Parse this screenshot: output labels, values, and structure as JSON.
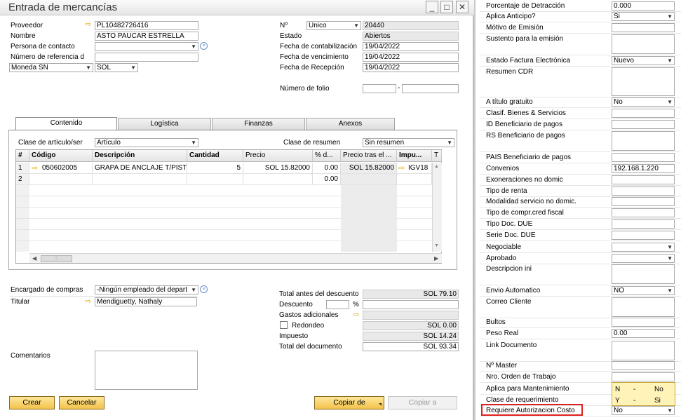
{
  "window": {
    "title": "Entrada de mercancías",
    "min": "_",
    "max": "□",
    "close": "✕"
  },
  "header_left": {
    "proveedor_label": "Proveedor",
    "proveedor": "PL10482726416",
    "nombre_label": "Nombre",
    "nombre": "ASTO PAUCAR ESTRELLA",
    "contacto_label": "Persona de contacto",
    "contacto": "",
    "referencia_label": "Número de referencia d",
    "referencia": "",
    "moneda_label": "Moneda SN",
    "moneda": "SOL"
  },
  "header_right": {
    "no_label": "Nº",
    "serie": "Unico",
    "numero": "20440",
    "estado_label": "Estado",
    "estado": "Abiertos",
    "fcont_label": "Fecha de contabilización",
    "fcont": "19/04/2022",
    "fvenc_label": "Fecha de vencimiento",
    "fvenc": "19/04/2022",
    "frec_label": "Fecha de Recepción",
    "frec": "19/04/2022",
    "folio_label": "Número de folio",
    "folio_sep": "-"
  },
  "tabs": [
    "Contenido",
    "Logística",
    "Finanzas",
    "Anexos"
  ],
  "content": {
    "clase_label": "Clase de artículo/ser",
    "clase": "Artículo",
    "resumen_label": "Clase de resumen",
    "resumen": "Sin resumen",
    "columns": [
      "#",
      "Código",
      "Descripción",
      "Cantidad",
      "Precio",
      "% d...",
      "Precio tras el ...",
      "Impu...",
      "T"
    ],
    "rows": [
      [
        "1",
        "050602005",
        "GRAPA DE ANCLAJE T/PIST",
        "5",
        "SOL 15.82000",
        "0.00",
        "SOL 15.82000",
        "IGV18"
      ],
      [
        "2",
        "",
        "",
        "",
        "",
        "0.00",
        "",
        ""
      ]
    ],
    "scroll_grip": ":::"
  },
  "footer_left": {
    "encargado_label": "Encargado de compras",
    "encargado": "-Ningún empleado del depart",
    "titular_label": "Titular",
    "titular": "Mendiguetty, Nathaly",
    "comentarios_label": "Comentarios"
  },
  "totals": {
    "antes_label": "Total antes del descuento",
    "antes": "SOL 79.10",
    "descuento_label": "Descuento",
    "pct": "%",
    "gastos_label": "Gastos adicionales",
    "redondeo_label": "Redondeo",
    "redondeo": "SOL 0.00",
    "impuesto_label": "Impuesto",
    "impuesto": "SOL 14.24",
    "total_label": "Total del documento",
    "total": "SOL 93.34"
  },
  "buttons": {
    "crear": "Crear",
    "cancelar": "Cancelar",
    "copiar_de": "Copiar de",
    "copiar_a": "Copiar a"
  },
  "udf": [
    {
      "label": "Porcentaje de Detracción",
      "value": "0.000"
    },
    {
      "label": "Aplica Anticipo?",
      "value": "Si"
    },
    {
      "label": "Mótivo de Emisión",
      "value": ""
    },
    {
      "label": "Sustento para la emisión",
      "value": ""
    },
    {
      "label": "Estado Factura Electrónica",
      "value": "Nuevo"
    },
    {
      "label": "Resumen CDR",
      "value": ""
    },
    {
      "label": "A título gratuito",
      "value": "No"
    },
    {
      "label": "Clasif. Bienes & Servicios",
      "value": ""
    },
    {
      "label": "ID Beneficiario de pagos",
      "value": ""
    },
    {
      "label": "RS Beneficiario de pagos",
      "value": ""
    },
    {
      "label": "PAIS Beneficiario de pagos",
      "value": ""
    },
    {
      "label": "Convenios",
      "value": "192.168.1.220"
    },
    {
      "label": "Exoneraciones no domic",
      "value": ""
    },
    {
      "label": "Tipo de renta",
      "value": ""
    },
    {
      "label": "Modalidad servicio no domic.",
      "value": ""
    },
    {
      "label": "Tipo de compr.cred fiscal",
      "value": ""
    },
    {
      "label": "Tipo Doc. DUE",
      "value": ""
    },
    {
      "label": "Serie Doc. DUE",
      "value": ""
    },
    {
      "label": "Negociable",
      "value": ""
    },
    {
      "label": "Aprobado",
      "value": ""
    },
    {
      "label": "Descripcion ini",
      "value": ""
    },
    {
      "label": "Envio Automatico",
      "value": "NO"
    },
    {
      "label": "Correo Cliente",
      "value": ""
    },
    {
      "label": "Bultos",
      "value": ""
    },
    {
      "label": "Peso Real",
      "value": "0.00"
    },
    {
      "label": "Link Documento",
      "value": ""
    },
    {
      "label": "Nº Master",
      "value": ""
    },
    {
      "label": "Nro. Orden de Trabajo",
      "value": ""
    },
    {
      "label": "Aplica para Mantenimiento",
      "value": ""
    },
    {
      "label": "Clase de requerimiento",
      "value": ""
    },
    {
      "label": "Requiere Autorizacion Costo",
      "value": "No"
    }
  ],
  "dropdown_options": [
    {
      "code": "N",
      "sep": "-",
      "text": "No"
    },
    {
      "code": "Y",
      "sep": "-",
      "text": "Si"
    }
  ],
  "colors": {
    "highlight_border": "#e0211f",
    "accent": "#f3c24b",
    "dropdown_bg": "#fff3b8"
  }
}
